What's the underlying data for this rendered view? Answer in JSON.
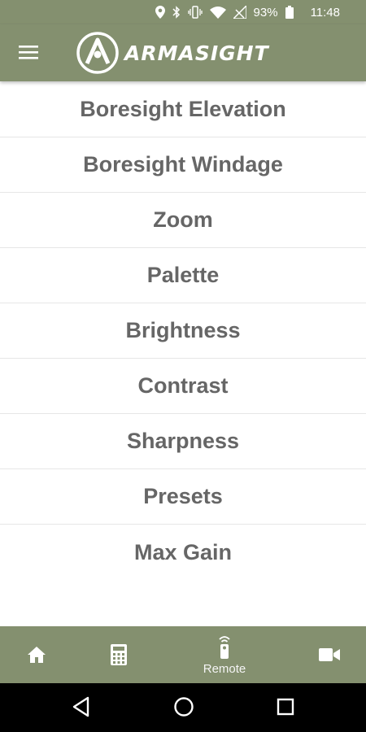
{
  "status_bar": {
    "battery_percent": "93%",
    "time": "11:48",
    "icons": [
      "location-icon",
      "bluetooth-icon",
      "vibrate-icon",
      "wifi-icon",
      "no-signal-icon",
      "battery-icon"
    ]
  },
  "header": {
    "menu_icon": "hamburger-icon",
    "logo_text": "ARMASIGHT"
  },
  "menu": {
    "items": [
      {
        "label": "Boresight Elevation"
      },
      {
        "label": "Boresight Windage"
      },
      {
        "label": "Zoom"
      },
      {
        "label": "Palette"
      },
      {
        "label": "Brightness"
      },
      {
        "label": "Contrast"
      },
      {
        "label": "Sharpness"
      },
      {
        "label": "Presets"
      },
      {
        "label": "Max Gain"
      }
    ]
  },
  "bottom_nav": {
    "items": [
      {
        "icon": "home-icon",
        "label": ""
      },
      {
        "icon": "calculator-icon",
        "label": ""
      },
      {
        "icon": "remote-icon",
        "label": "Remote"
      },
      {
        "icon": "video-camera-icon",
        "label": ""
      }
    ]
  },
  "system_nav": {
    "icons": [
      "back-icon",
      "home-circle-icon",
      "recents-icon"
    ]
  },
  "colors": {
    "accent": "#84906f",
    "text": "#666666",
    "background": "#ffffff"
  }
}
